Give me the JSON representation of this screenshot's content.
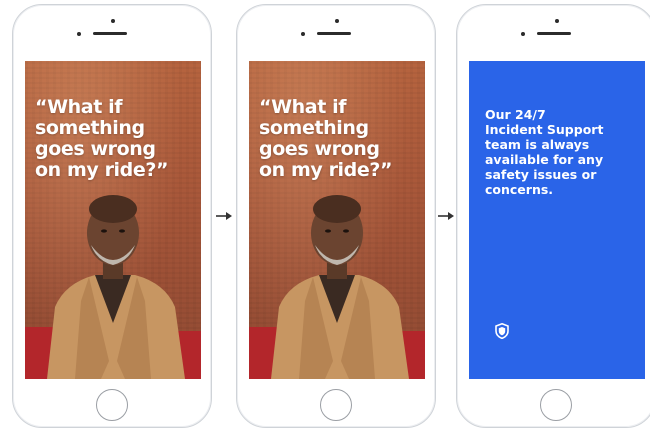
{
  "screens": [
    {
      "quote_lines": [
        "“What if",
        "something",
        "goes wrong",
        "on my ride?”"
      ]
    },
    {
      "quote_lines": [
        "“What if",
        "something",
        "goes wrong",
        "on my ride?”"
      ]
    },
    {
      "message_lines": [
        "Our 24/7",
        "Incident Support",
        "team is always",
        "available for any",
        "safety issues or",
        "concerns."
      ],
      "icon": "shield-icon"
    }
  ],
  "colors": {
    "accent_blue": "#2a64e8",
    "photo_background": "#a9583a",
    "text_white": "#ffffff"
  }
}
